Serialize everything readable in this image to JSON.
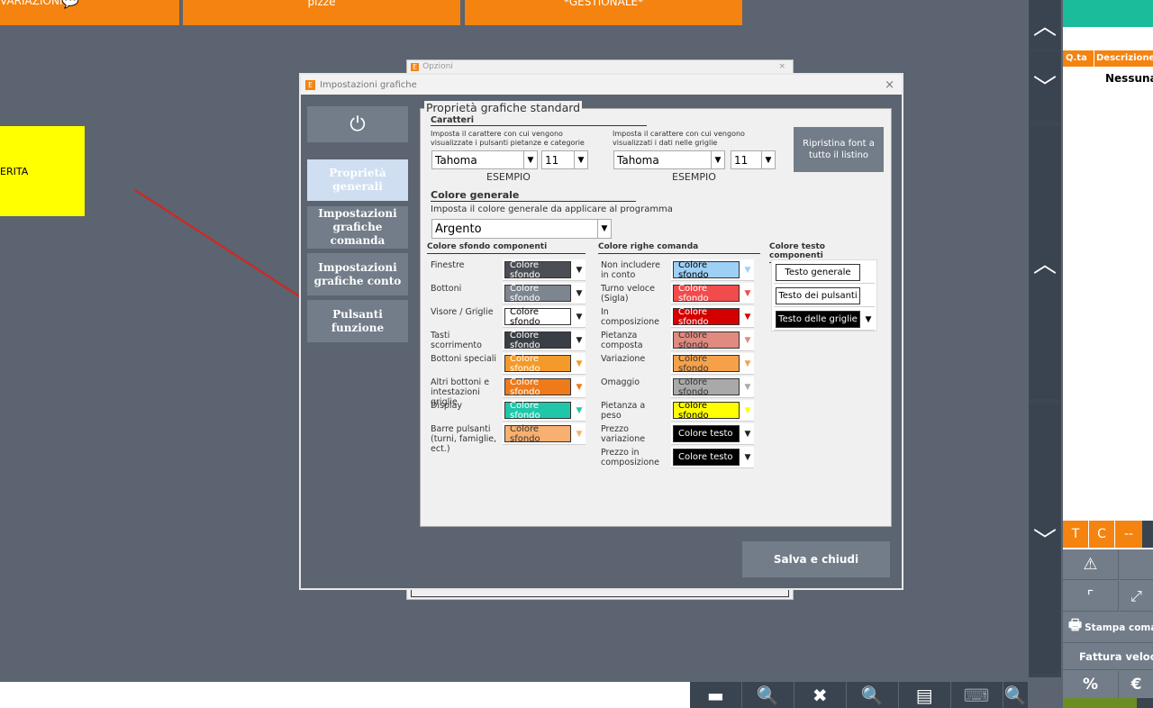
{
  "top_buttons": [
    {
      "label": "VARIAZIONI"
    },
    {
      "label": "pizze"
    },
    {
      "label": "*GESTIONALE*"
    }
  ],
  "left_tile": {
    "label": "ERITA",
    "color": "#ffff00"
  },
  "right_panel": {
    "col_qty": "Q.ta",
    "col_desc": "Descrizione",
    "empty_text": "Nessuna",
    "small_btns": [
      "T",
      "C",
      "--"
    ],
    "print_label": "Stampa coma",
    "invoice_label": "Fattura veloc",
    "percent": "%",
    "euro": "€"
  },
  "back_window": {
    "title": "Opzioni"
  },
  "dialog": {
    "icon_letter": "E",
    "title": "Impostazioni grafiche",
    "close": "×",
    "power_icon": "⏻",
    "nav": [
      {
        "label": "Proprietà generali"
      },
      {
        "label": "Impostazioni grafiche comanda"
      },
      {
        "label": "Impostazioni grafiche conto"
      },
      {
        "label": "Pulsanti funzione"
      }
    ],
    "group_title": "Proprietà grafiche standard",
    "fonts": {
      "header": "Caratteri",
      "left_desc": "Imposta il carattere con cui vengono visualizzate i pulsanti pietanze e categorie",
      "left_font": "Tahoma",
      "left_size": "11",
      "right_desc": "Imposta il carattere con cui vengono visualizzati i dati nelle griglie",
      "right_font": "Tahoma",
      "right_size": "11",
      "example": "ESEMPIO",
      "reset_button": "Ripristina font a tutto il listino"
    },
    "general_color": {
      "header": "Colore generale",
      "desc": "Imposta il colore generale da applicare al programma",
      "value": "Argento"
    },
    "bg_components": {
      "header": "Colore sfondo componenti",
      "rows": [
        {
          "label": "Finestre",
          "value": "Colore sfondo",
          "color": "#4b4f55",
          "text": "#ffffff"
        },
        {
          "label": "Bottoni",
          "value": "Colore sfondo",
          "color": "#7d8591",
          "text": "#ffffff"
        },
        {
          "label": "Visore / Griglie",
          "value": "Colore sfondo",
          "color": "#ffffff",
          "text": "#000000"
        },
        {
          "label": "Tasti scorrimento",
          "value": "Colore sfondo",
          "color": "#3a3f46",
          "text": "#ffffff"
        },
        {
          "label": "Bottoni speciali",
          "value": "Colore sfondo",
          "color": "#f39a2b",
          "text": "#ffffff"
        },
        {
          "label": "Altri bottoni e intestazioni griglie",
          "value": "Colore sfondo",
          "color": "#ef7a1a",
          "text": "#ffffff"
        },
        {
          "label": "Display",
          "value": "Colore sfondo",
          "color": "#1fc7a8",
          "text": "#ffffff"
        },
        {
          "label": "Barre pulsanti (turni, famiglie, ect.)",
          "value": "Colore sfondo",
          "color": "#f8b070",
          "text": "#333333"
        }
      ]
    },
    "row_colors": {
      "header": "Colore righe comanda",
      "rows": [
        {
          "label": "Non includere in conto",
          "value": "Colore sfondo",
          "color": "#9ed0f5",
          "text": "#000000"
        },
        {
          "label": "Turno veloce (Sigla)",
          "value": "Colore sfondo",
          "color": "#f24b4b",
          "text": "#ffffff"
        },
        {
          "label": "In composizione",
          "value": "Colore sfondo",
          "color": "#d40000",
          "text": "#ffffff"
        },
        {
          "label": "Pietanza composta",
          "value": "Colore sfondo",
          "color": "#e08a80",
          "text": "#333333"
        },
        {
          "label": "Variazione",
          "value": "Colore sfondo",
          "color": "#f6a14a",
          "text": "#333333"
        },
        {
          "label": "Omaggio",
          "value": "Colore sfondo",
          "color": "#a9a9a9",
          "text": "#333333"
        },
        {
          "label": "Pietanza a peso",
          "value": "Colore sfondo",
          "color": "#ffff00",
          "text": "#000000"
        },
        {
          "label": "Prezzo variazione",
          "value": "Colore testo",
          "color": "#000000",
          "text": "#ffffff"
        },
        {
          "label": "Prezzo in composizione",
          "value": "Colore testo",
          "color": "#000000",
          "text": "#ffffff"
        }
      ]
    },
    "text_components": {
      "header": "Colore testo componenti",
      "rows": [
        {
          "value": "Testo generale",
          "color": "#ffffff",
          "text": "#000000"
        },
        {
          "value": "Testo dei pulsanti",
          "color": "#ffffff",
          "text": "#000000"
        },
        {
          "value": "Testo delle griglie",
          "color": "#000000",
          "text": "#ffffff"
        }
      ]
    },
    "save_button": "Salva e chiudi"
  },
  "accent": "#f4830f",
  "teal": "#1abc9c"
}
